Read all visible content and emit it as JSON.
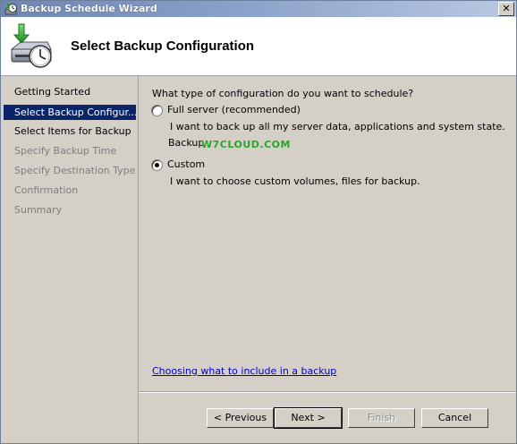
{
  "window": {
    "title": "Backup Schedule Wizard",
    "close_glyph": "✕"
  },
  "header": {
    "title": "Select Backup Configuration",
    "icon": "backup-schedule-icon"
  },
  "nav": {
    "items": [
      {
        "label": "Getting Started",
        "state": "done"
      },
      {
        "label": "Select Backup Configur...",
        "state": "active"
      },
      {
        "label": "Select Items for Backup",
        "state": "done"
      },
      {
        "label": "Specify Backup Time",
        "state": "disabled"
      },
      {
        "label": "Specify Destination Type",
        "state": "disabled"
      },
      {
        "label": "Confirmation",
        "state": "disabled"
      },
      {
        "label": "Summary",
        "state": "disabled"
      }
    ]
  },
  "content": {
    "question": "What type of configuration do you want to schedule?",
    "options": [
      {
        "label": "Full server (recommended)",
        "description": "I want to back up all my server data, applications and system state.",
        "extra": "Backup",
        "selected": false
      },
      {
        "label": "Custom",
        "description": "I want to choose custom volumes, files for backup.",
        "selected": true
      }
    ],
    "watermark": "W7CLOUD.COM",
    "help_link": "Choosing what to include in a backup"
  },
  "buttons": {
    "previous": "< Previous",
    "next": "Next >",
    "finish": "Finish",
    "cancel": "Cancel"
  },
  "colors": {
    "selection": "#0a246a",
    "link": "#0000cc",
    "watermark": "#2aa52a"
  }
}
